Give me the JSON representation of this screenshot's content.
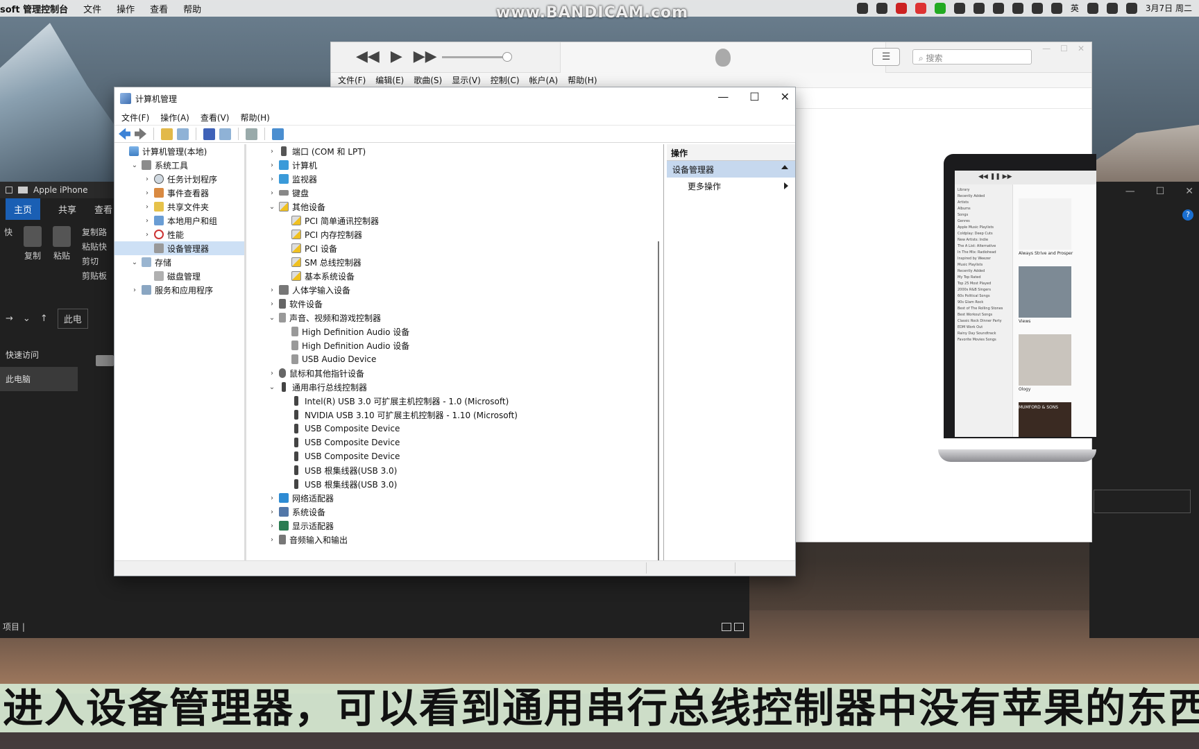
{
  "menubar": {
    "app_name": "soft 管理控制台",
    "items": [
      "文件",
      "操作",
      "查看",
      "帮助"
    ],
    "watermark": "www.BANDICAM.com",
    "ime": "英",
    "date": "3月7日 周二"
  },
  "explorer": {
    "title": "Apple iPhone",
    "tabs": [
      "主页",
      "共享",
      "查看"
    ],
    "ribbon": [
      "快",
      "复制",
      "粘贴",
      "复制路",
      "粘贴快",
      "剪切",
      "剪贴板"
    ],
    "address": "此电",
    "nav": [
      "快速访问",
      "此电脑"
    ],
    "status": "项目 |"
  },
  "itunes": {
    "menu": [
      "文件(F)",
      "编辑(E)",
      "歌曲(S)",
      "显示(V)",
      "控制(C)",
      "帐户(A)",
      "帮助(H)"
    ],
    "search_placeholder": "搜索",
    "laptop": {
      "toolbar": "◀◀ ❚❚ ▶▶",
      "sidebar": [
        "Library",
        "Recently Added",
        "Artists",
        "Albums",
        "Songs",
        "Genres",
        "Apple Music Playlists",
        "Coldplay: Deep Cuts",
        "New Artists: Indie",
        "The A List: Alternative",
        "In The Mix: Radiohead",
        "Inspired by Weezer",
        "Music Playlists",
        "Recently Added",
        "My Top Rated",
        "Top 25 Most Played",
        "2000s R&B Singers",
        "60s Political Songs",
        "90s Glam Rock",
        "Best of The Rolling Stones",
        "Best Workout Songs",
        "Classic Rock Dinner Party",
        "EDM Work Out",
        "Rainy Day Soundtrack",
        "Favorite Movies Songs"
      ],
      "albums": [
        {
          "title": "Always Strive and Prosper",
          "color": "#f2f2f2"
        },
        {
          "title": "Views",
          "color": "#7d8a95"
        },
        {
          "title": "Ology",
          "color": "#c9c4bd"
        },
        {
          "title": "MUMFORD & SONS",
          "color": "#3a2a22"
        }
      ]
    }
  },
  "cm": {
    "title": "计算机管理",
    "menu": [
      "文件(F)",
      "操作(A)",
      "查看(V)",
      "帮助(H)"
    ],
    "tree": [
      {
        "label": "计算机管理(本地)",
        "indent": 0,
        "chev": "",
        "icon": "ic-comp"
      },
      {
        "label": "系统工具",
        "indent": 1,
        "chev": "⌄",
        "icon": "ic-tools"
      },
      {
        "label": "任务计划程序",
        "indent": 2,
        "chev": "›",
        "icon": "ic-clock"
      },
      {
        "label": "事件查看器",
        "indent": 2,
        "chev": "›",
        "icon": "ic-log"
      },
      {
        "label": "共享文件夹",
        "indent": 2,
        "chev": "›",
        "icon": "ic-share"
      },
      {
        "label": "本地用户和组",
        "indent": 2,
        "chev": "›",
        "icon": "ic-users"
      },
      {
        "label": "性能",
        "indent": 2,
        "chev": "›",
        "icon": "ic-perf"
      },
      {
        "label": "设备管理器",
        "indent": 2,
        "chev": "",
        "icon": "ic-dev",
        "selected": true
      },
      {
        "label": "存储",
        "indent": 1,
        "chev": "⌄",
        "icon": "ic-store"
      },
      {
        "label": "磁盘管理",
        "indent": 2,
        "chev": "",
        "icon": "ic-disk"
      },
      {
        "label": "服务和应用程序",
        "indent": 1,
        "chev": "›",
        "icon": "ic-svc"
      }
    ],
    "devices": [
      {
        "label": "端口 (COM 和 LPT)",
        "indent": 1,
        "chev": "›",
        "icon": "ic-port"
      },
      {
        "label": "计算机",
        "indent": 1,
        "chev": "›",
        "icon": "ic-monitor"
      },
      {
        "label": "监视器",
        "indent": 1,
        "chev": "›",
        "icon": "ic-monitor"
      },
      {
        "label": "键盘",
        "indent": 1,
        "chev": "›",
        "icon": "ic-kbd"
      },
      {
        "label": "其他设备",
        "indent": 1,
        "chev": "⌄",
        "icon": "ic-warn"
      },
      {
        "label": "PCI 简单通讯控制器",
        "indent": 2,
        "chev": "",
        "icon": "ic-warn"
      },
      {
        "label": "PCI 内存控制器",
        "indent": 2,
        "chev": "",
        "icon": "ic-warn"
      },
      {
        "label": "PCI 设备",
        "indent": 2,
        "chev": "",
        "icon": "ic-warn"
      },
      {
        "label": "SM 总线控制器",
        "indent": 2,
        "chev": "",
        "icon": "ic-warn"
      },
      {
        "label": "基本系统设备",
        "indent": 2,
        "chev": "",
        "icon": "ic-warn"
      },
      {
        "label": "人体学输入设备",
        "indent": 1,
        "chev": "›",
        "icon": "ic-hid"
      },
      {
        "label": "软件设备",
        "indent": 1,
        "chev": "›",
        "icon": "ic-soft"
      },
      {
        "label": "声音、视频和游戏控制器",
        "indent": 1,
        "chev": "⌄",
        "icon": "ic-speaker"
      },
      {
        "label": "High Definition Audio 设备",
        "indent": 2,
        "chev": "",
        "icon": "ic-speaker"
      },
      {
        "label": "High Definition Audio 设备",
        "indent": 2,
        "chev": "",
        "icon": "ic-speaker"
      },
      {
        "label": "USB Audio Device",
        "indent": 2,
        "chev": "",
        "icon": "ic-speaker"
      },
      {
        "label": "鼠标和其他指针设备",
        "indent": 1,
        "chev": "›",
        "icon": "ic-mouse"
      },
      {
        "label": "通用串行总线控制器",
        "indent": 1,
        "chev": "⌄",
        "icon": "ic-usb"
      },
      {
        "label": "Intel(R) USB 3.0 可扩展主机控制器 - 1.0 (Microsoft)",
        "indent": 2,
        "chev": "",
        "icon": "ic-usb"
      },
      {
        "label": "NVIDIA USB 3.10 可扩展主机控制器 - 1.10 (Microsoft)",
        "indent": 2,
        "chev": "",
        "icon": "ic-usb"
      },
      {
        "label": "USB Composite Device",
        "indent": 2,
        "chev": "",
        "icon": "ic-usb"
      },
      {
        "label": "USB Composite Device",
        "indent": 2,
        "chev": "",
        "icon": "ic-usb"
      },
      {
        "label": "USB Composite Device",
        "indent": 2,
        "chev": "",
        "icon": "ic-usb"
      },
      {
        "label": "USB 根集线器(USB 3.0)",
        "indent": 2,
        "chev": "",
        "icon": "ic-usb"
      },
      {
        "label": "USB 根集线器(USB 3.0)",
        "indent": 2,
        "chev": "",
        "icon": "ic-usb"
      },
      {
        "label": "网络适配器",
        "indent": 1,
        "chev": "›",
        "icon": "ic-net"
      },
      {
        "label": "系统设备",
        "indent": 1,
        "chev": "›",
        "icon": "ic-sys"
      },
      {
        "label": "显示适配器",
        "indent": 1,
        "chev": "›",
        "icon": "ic-disp"
      },
      {
        "label": "音频输入和输出",
        "indent": 1,
        "chev": "›",
        "icon": "ic-audio"
      }
    ],
    "actions": {
      "header": "操作",
      "section": "设备管理器",
      "more": "更多操作"
    }
  },
  "caption": "进入设备管理器，可以看到通用串行总线控制器中没有苹果的东西"
}
